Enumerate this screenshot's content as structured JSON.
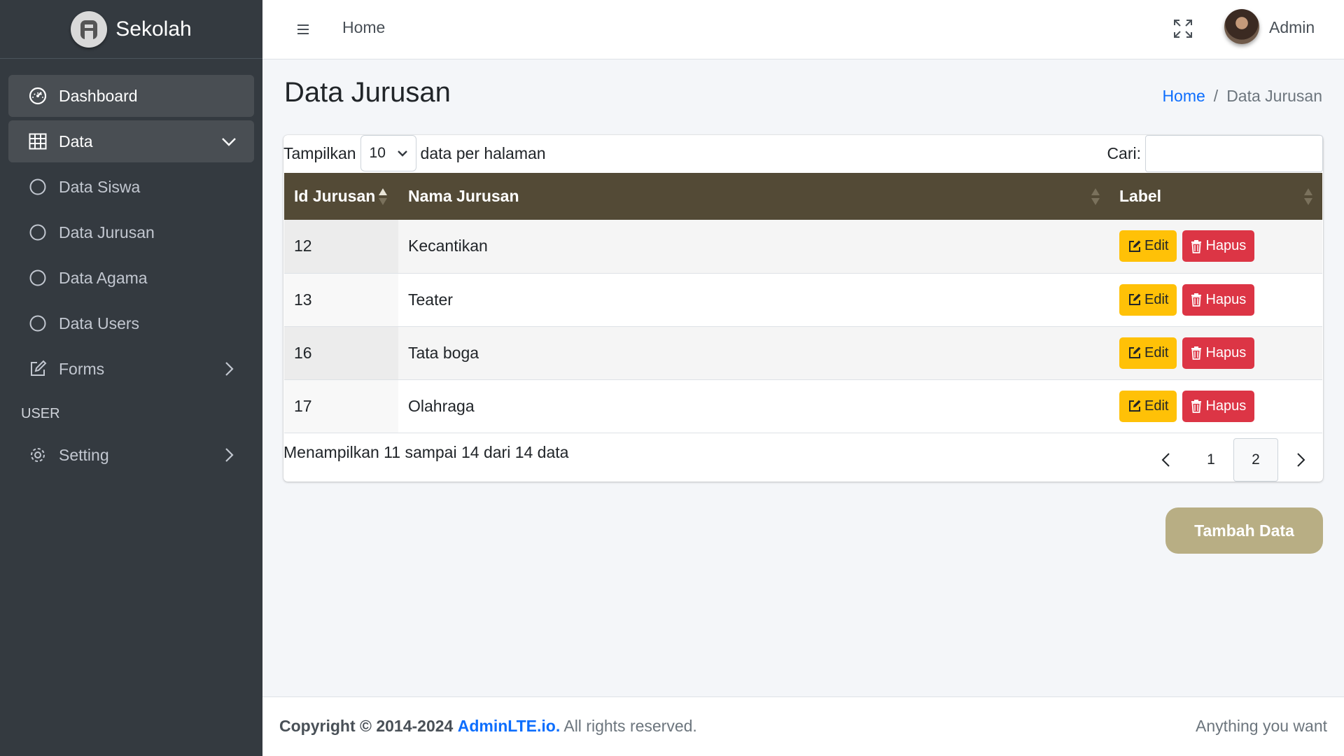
{
  "brand": {
    "name": "Sekolah",
    "logo_icon": "adminlte-logo-icon"
  },
  "sidebar": {
    "items": [
      {
        "label": "Dashboard",
        "icon": "speedometer-icon"
      },
      {
        "label": "Data",
        "icon": "table-icon"
      },
      {
        "label": "Data Siswa",
        "icon": "circle-icon"
      },
      {
        "label": "Data Jurusan",
        "icon": "circle-icon"
      },
      {
        "label": "Data Agama",
        "icon": "circle-icon"
      },
      {
        "label": "Data Users",
        "icon": "circle-icon"
      },
      {
        "label": "Forms",
        "icon": "pencil-square-icon"
      }
    ],
    "section_header": "USER",
    "setting": {
      "label": "Setting",
      "icon": "gear-icon"
    }
  },
  "topbar": {
    "home": "Home",
    "user": "Admin"
  },
  "page": {
    "title": "Data Jurusan",
    "breadcrumb": {
      "home": "Home",
      "separator": "/",
      "current": "Data Jurusan"
    }
  },
  "table_controls": {
    "show_prefix": "Tampilkan",
    "page_length": "10",
    "show_suffix": "data per halaman",
    "search_label": "Cari:"
  },
  "table": {
    "headers": [
      "Id Jurusan",
      "Nama Jurusan",
      "Label"
    ],
    "rows": [
      {
        "id": "12",
        "nama": "Kecantikan"
      },
      {
        "id": "13",
        "nama": "Teater"
      },
      {
        "id": "16",
        "nama": "Tata boga"
      },
      {
        "id": "17",
        "nama": "Olahraga"
      }
    ],
    "edit_label": "Edit",
    "delete_label": "Hapus"
  },
  "pagination": {
    "info": "Menampilkan 11 sampai 14 dari 14 data",
    "pages": [
      "1",
      "2"
    ],
    "current": "2"
  },
  "add_button": "Tambah Data",
  "footer": {
    "copyright": "Copyright © 2014-2024",
    "brand_link": "AdminLTE.io.",
    "rights": "All rights reserved.",
    "right_text": "Anything you want"
  },
  "colors": {
    "sidebar_bg": "#343a40",
    "table_header_bg": "#534a36",
    "edit_button": "#ffc107",
    "delete_button": "#dc3545",
    "add_button": "#b8ae84",
    "link": "#0d6efd"
  }
}
